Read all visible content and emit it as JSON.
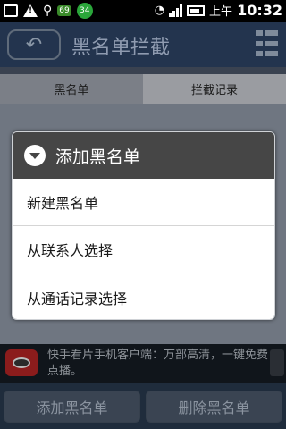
{
  "status_bar": {
    "icons": [
      "notification-box-icon",
      "warning-icon",
      "usb-icon",
      "badge-69",
      "badge-34",
      "wifi-icon",
      "signal-icon",
      "battery-icon"
    ],
    "badge_69": "69",
    "badge_34": "34",
    "ampm": "上午",
    "time": "10:32"
  },
  "titlebar": {
    "back_icon": "back-arrow-icon",
    "title": "黑名单拦截",
    "menu_icon": "list-menu-icon"
  },
  "tabs": [
    {
      "label": "黑名单",
      "active": true
    },
    {
      "label": "拦截记录",
      "active": false
    }
  ],
  "dialog": {
    "title": "添加黑名单",
    "items": [
      "新建黑名单",
      "从联系人选择",
      "从通话记录选择"
    ]
  },
  "ad": {
    "text": "快手看片手机客户端：万部高清，一键免费点播。"
  },
  "bottom_buttons": {
    "add": "添加黑名单",
    "delete": "删除黑名单"
  },
  "colors": {
    "titlebar_bg": "#23344e",
    "dialog_header_bg": "#464646",
    "dialog_list_bg": "#ffffff",
    "dim_overlay": "#3a4250"
  }
}
